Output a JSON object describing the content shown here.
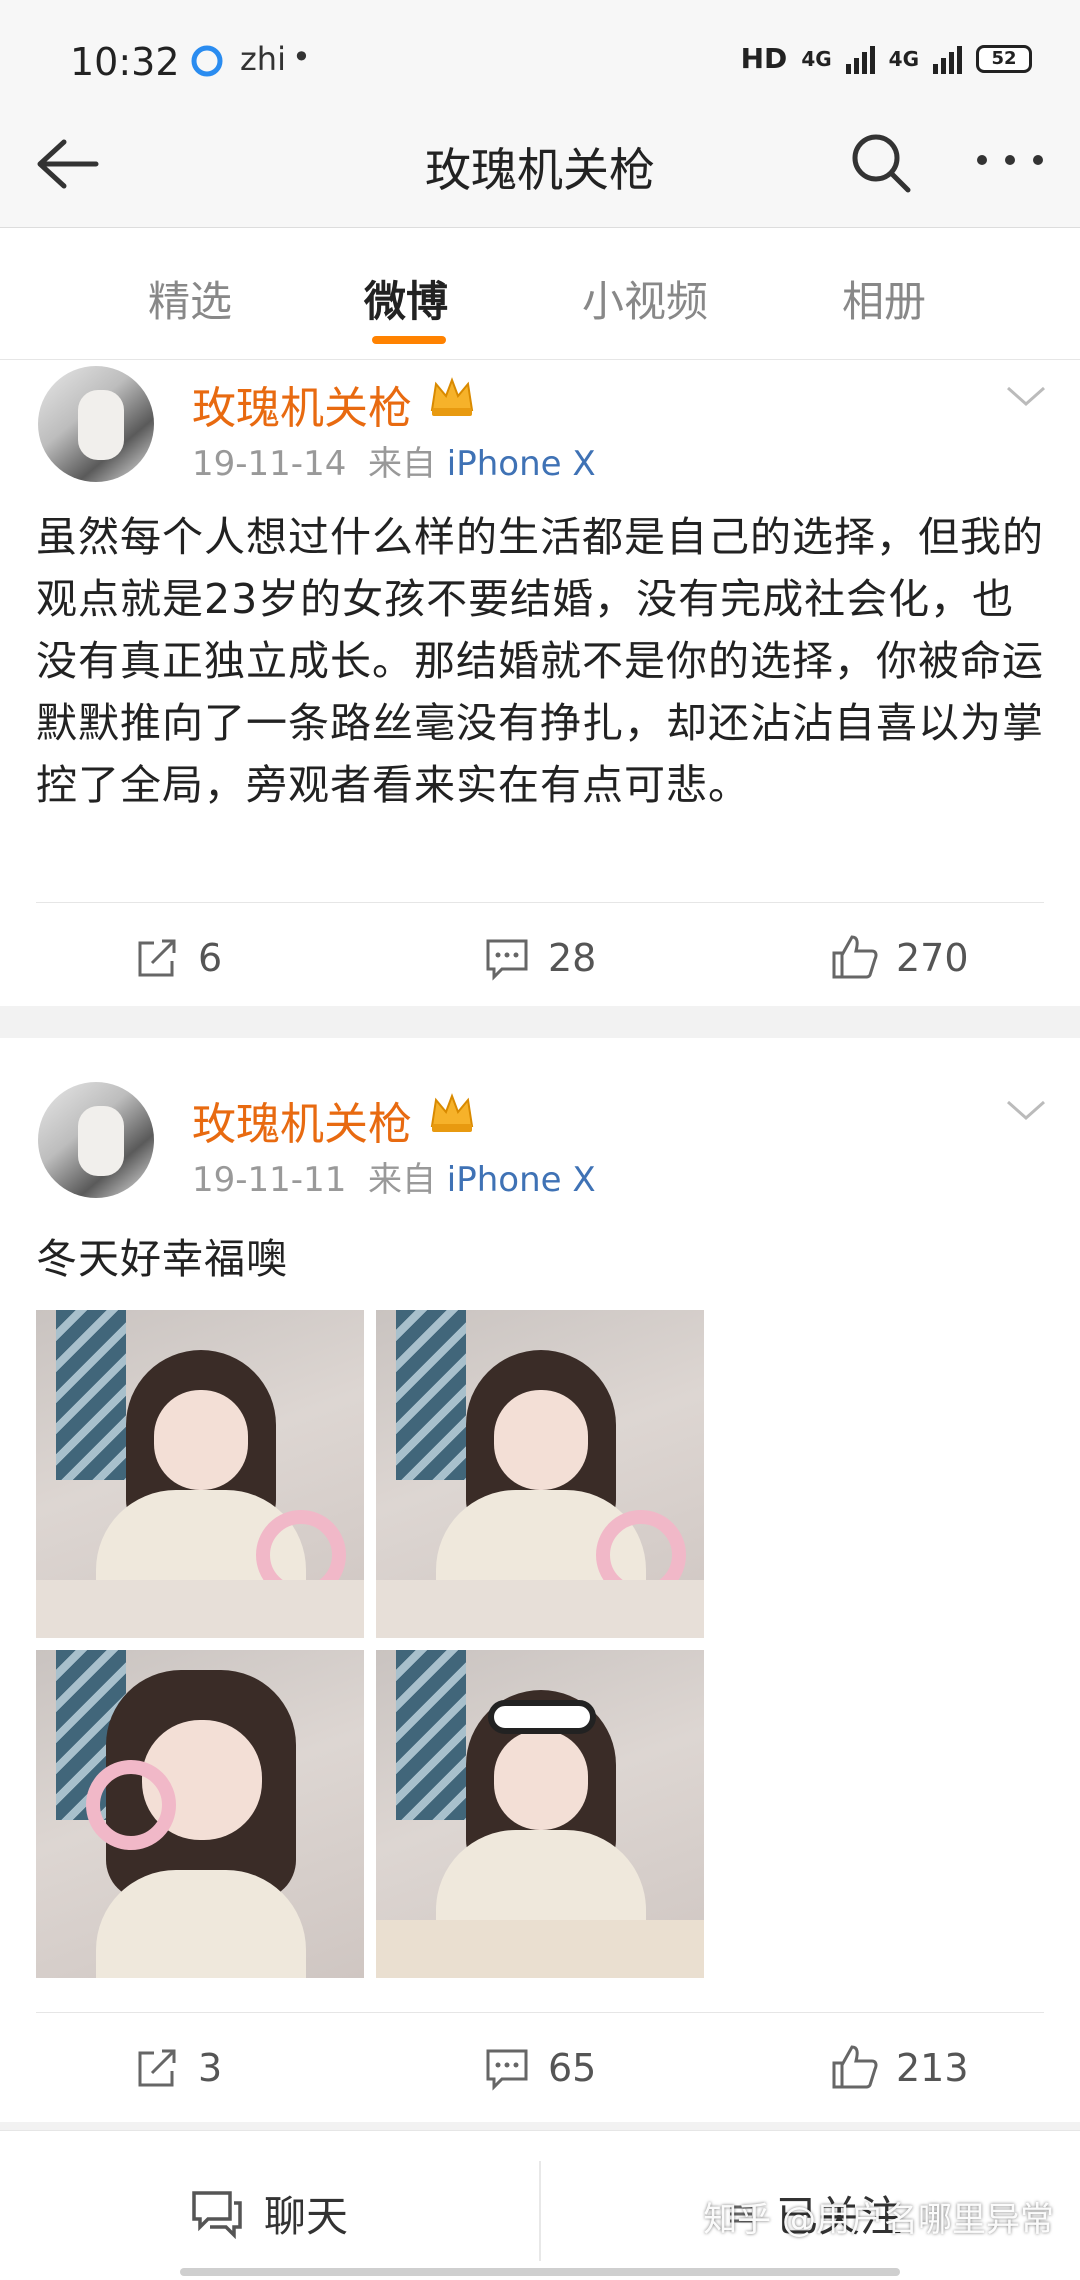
{
  "status_bar": {
    "time": "10:32",
    "app_icon_1": "qq-browser-icon",
    "app_icon_2": "zhi",
    "dot": "•",
    "hd": "HD",
    "net1": "4G",
    "net2": "4G",
    "battery": "52"
  },
  "nav": {
    "title": "玫瑰机关枪",
    "back_icon": "back-arrow-icon",
    "search_icon": "search-icon",
    "more_icon": "more-icon"
  },
  "tabs": [
    {
      "label": "精选"
    },
    {
      "label": "微博"
    },
    {
      "label": "小视频"
    },
    {
      "label": "相册"
    }
  ],
  "posts": [
    {
      "username": "玫瑰机关枪",
      "date": "19-11-14",
      "from": "来自",
      "source": "iPhone X",
      "text": "虽然每个人想过什么样的生活都是自己的选择，但我的观点就是23岁的女孩不要结婚，没有完成社会化，也没有真正独立成长。那结婚就不是你的选择，你被命运默默推向了一条路丝毫没有挣扎，却还沾沾自喜以为掌控了全局，旁观者看来实在有点可悲。",
      "reposts": "6",
      "comments": "28",
      "likes": "270"
    },
    {
      "username": "玫瑰机关枪",
      "date": "19-11-11",
      "from": "来自",
      "source": "iPhone X",
      "text": "冬天好幸福噢",
      "reposts": "3",
      "comments": "65",
      "likes": "213"
    }
  ],
  "bottom": {
    "chat_label": "聊天",
    "follow_label": "已关注",
    "chat_icon": "chat-icon",
    "follow_icon": "menu-icon"
  },
  "watermark": "知乎 @用户名哪里异常",
  "colors": {
    "accent": "#ff8200",
    "username": "#e86a10",
    "source_link": "#3f72b5"
  }
}
